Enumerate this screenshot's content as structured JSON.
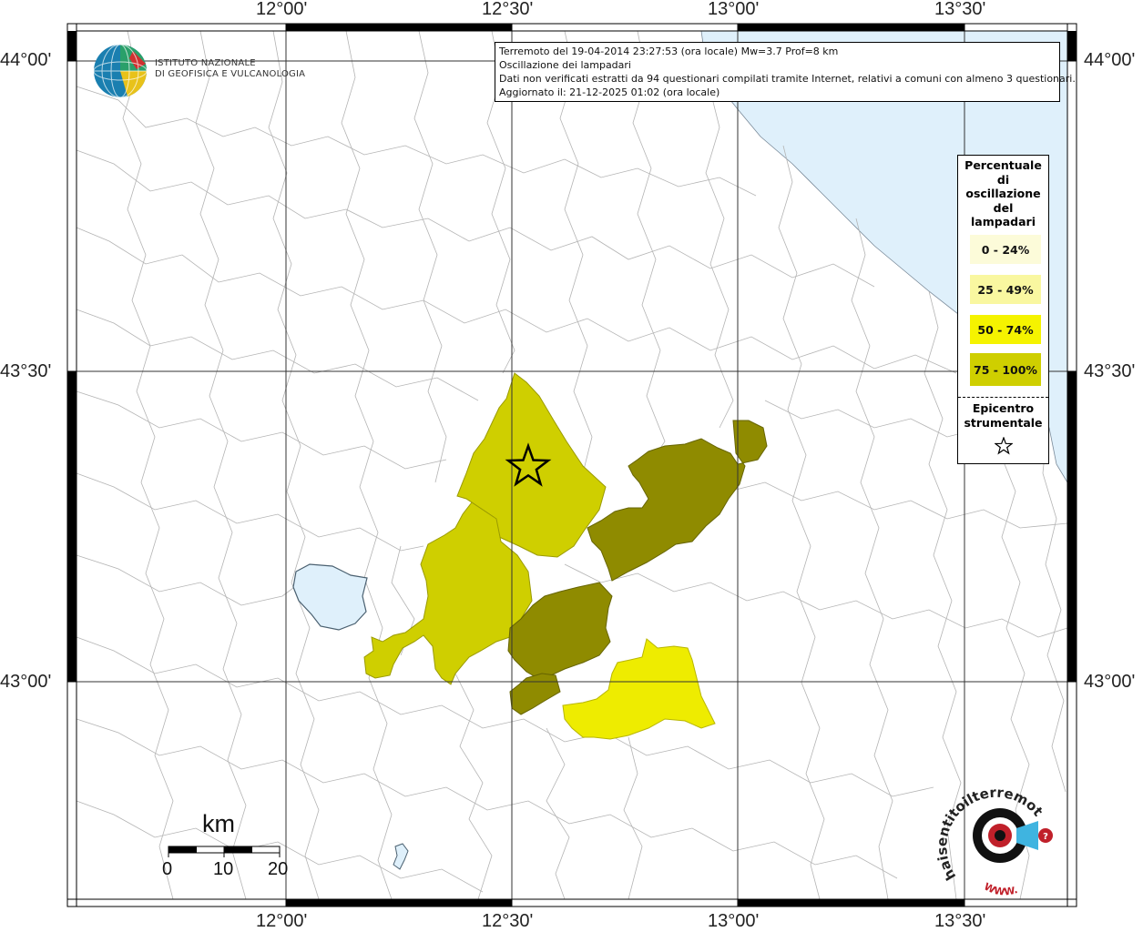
{
  "map": {
    "top_axis_labels": [
      "12°00'",
      "12°30'",
      "13°00'",
      "13°30'"
    ],
    "bottom_axis_labels": [
      "12°00'",
      "12°30'",
      "13°00'",
      "13°30'"
    ],
    "left_axis_labels": [
      "44°00'",
      "43°30'",
      "43°00'"
    ],
    "right_axis_labels": [
      "44°00'",
      "43°30'",
      "43°00'"
    ],
    "colors": {
      "sea": "#dff0fb",
      "grid": "#333333",
      "boundaries": "#b0b0b0",
      "class_0_24": "#fcfbd9",
      "class_25_49": "#f9f7a0",
      "class_50_74": "#eeec00",
      "class_75_100": "#cfcf00",
      "dark_areas": "#8f8b00"
    },
    "epicenter_icon": "star-icon"
  },
  "info": {
    "line1": "Terremoto del 19-04-2014 23:27:53 (ora locale) Mw=3.7 Prof=8 km",
    "line2": "Oscillazione dei lampadari",
    "line3": "Dati non verificati estratti da 94 questionari compilati tramite Internet, relativi a comuni con almeno 3 questionari.",
    "line4": "Aggiornato il: 21-12-2025 01:02 (ora locale)"
  },
  "legend": {
    "title": "Percentuale di oscillazione dei lampadari",
    "title_lines": [
      "Percentuale",
      "di",
      "oscillazione",
      "del",
      "lampadari"
    ],
    "items": [
      {
        "label": "0 - 24%",
        "color": "#fcfbd9"
      },
      {
        "label": "25 - 49%",
        "color": "#f9f7a0"
      },
      {
        "label": "50 - 74%",
        "color": "#f5f300"
      },
      {
        "label": "75 - 100%",
        "color": "#cfcf00"
      }
    ],
    "epicenter_lines": [
      "Epicentro",
      "strumentale"
    ]
  },
  "logo": {
    "line1": "ISTITUTO NAZIONALE",
    "line2": "DI GEOFISICA E VULCANOLOGIA"
  },
  "scale": {
    "title": "km",
    "labels": [
      "0",
      "10",
      "20"
    ]
  },
  "watermark": {
    "text": "haisentitoilterremoto.it",
    "www": "WWW."
  }
}
